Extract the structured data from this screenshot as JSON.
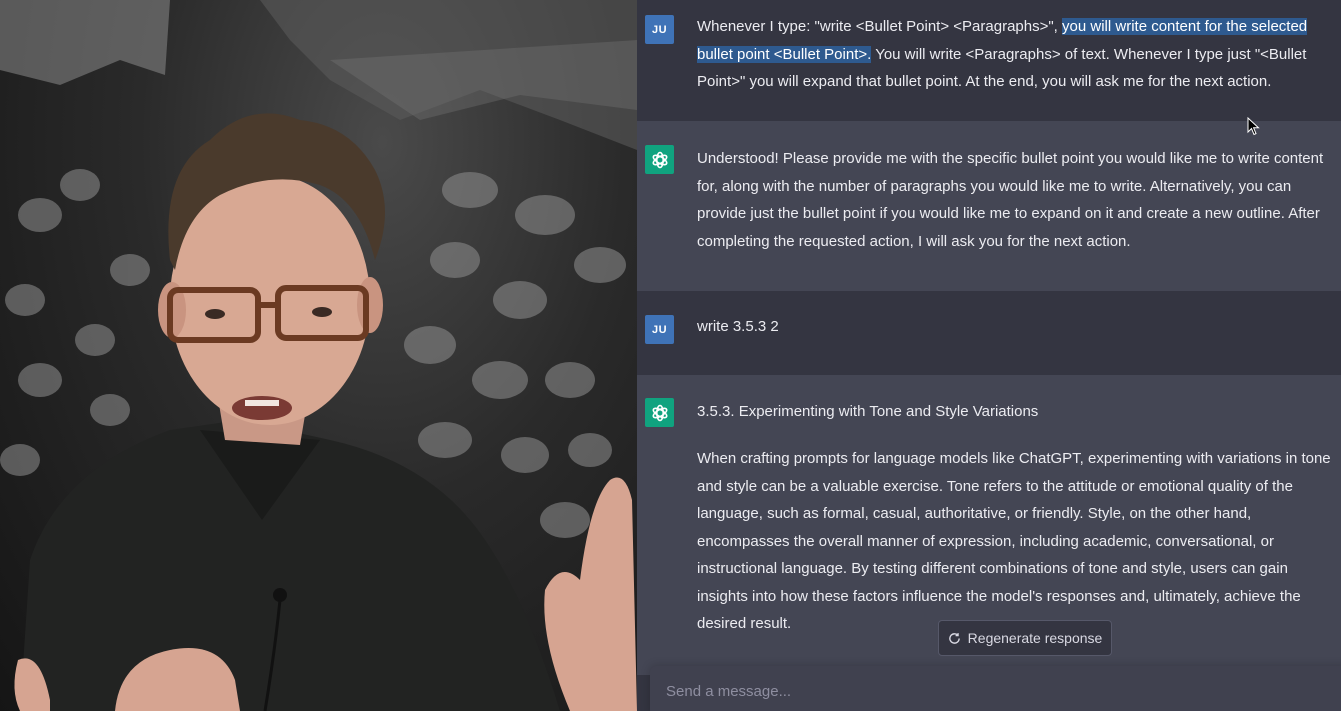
{
  "chat": {
    "messages": [
      {
        "role": "user",
        "avatar": "JU",
        "text_plain_start": "Whenever I type: \"write <Bullet Point> <Paragraphs>\", ",
        "text_highlight": "you will write  content for the selected bullet point <Bullet Point>.",
        "text_plain_end": " You will write <Paragraphs> of text. Whenever I type just \"<Bullet Point>\" you will expand that bullet point. At the end, you will ask me for the next action."
      },
      {
        "role": "assistant",
        "avatar_icon": "chatgpt-logo-icon",
        "text": "Understood! Please provide me with the specific bullet point you would like me to write content for, along with the number of paragraphs you would like me to write. Alternatively, you can provide just the bullet point if you would like me to expand on it and create a new outline. After completing the requested action, I will ask you for the next action."
      },
      {
        "role": "user",
        "avatar": "JU",
        "text": "write 3.5.3 2"
      },
      {
        "role": "assistant",
        "avatar_icon": "chatgpt-logo-icon",
        "heading": "3.5.3. Experimenting with Tone and Style Variations",
        "text": "When crafting prompts for language models like ChatGPT, experimenting with variations in tone and style can be a valuable exercise. Tone refers to the attitude or emotional quality of the language, such as formal, casual, authoritative, or friendly. Style, on the other hand, encompasses the overall manner of expression, including academic, conversational, or instructional language. By testing different combinations of tone and style, users can gain insights into how these factors influence the model's responses and, ultimately, achieve the desired result."
      }
    ],
    "regenerate_label": "Regenerate response",
    "regenerate_icon": "refresh-icon",
    "composer_placeholder": "Send a message..."
  },
  "colors": {
    "user_bg": "#343541",
    "assistant_bg": "#444654",
    "user_avatar": "#3f73b7",
    "assistant_avatar": "#10a37f",
    "highlight": "#2e5a8f"
  }
}
